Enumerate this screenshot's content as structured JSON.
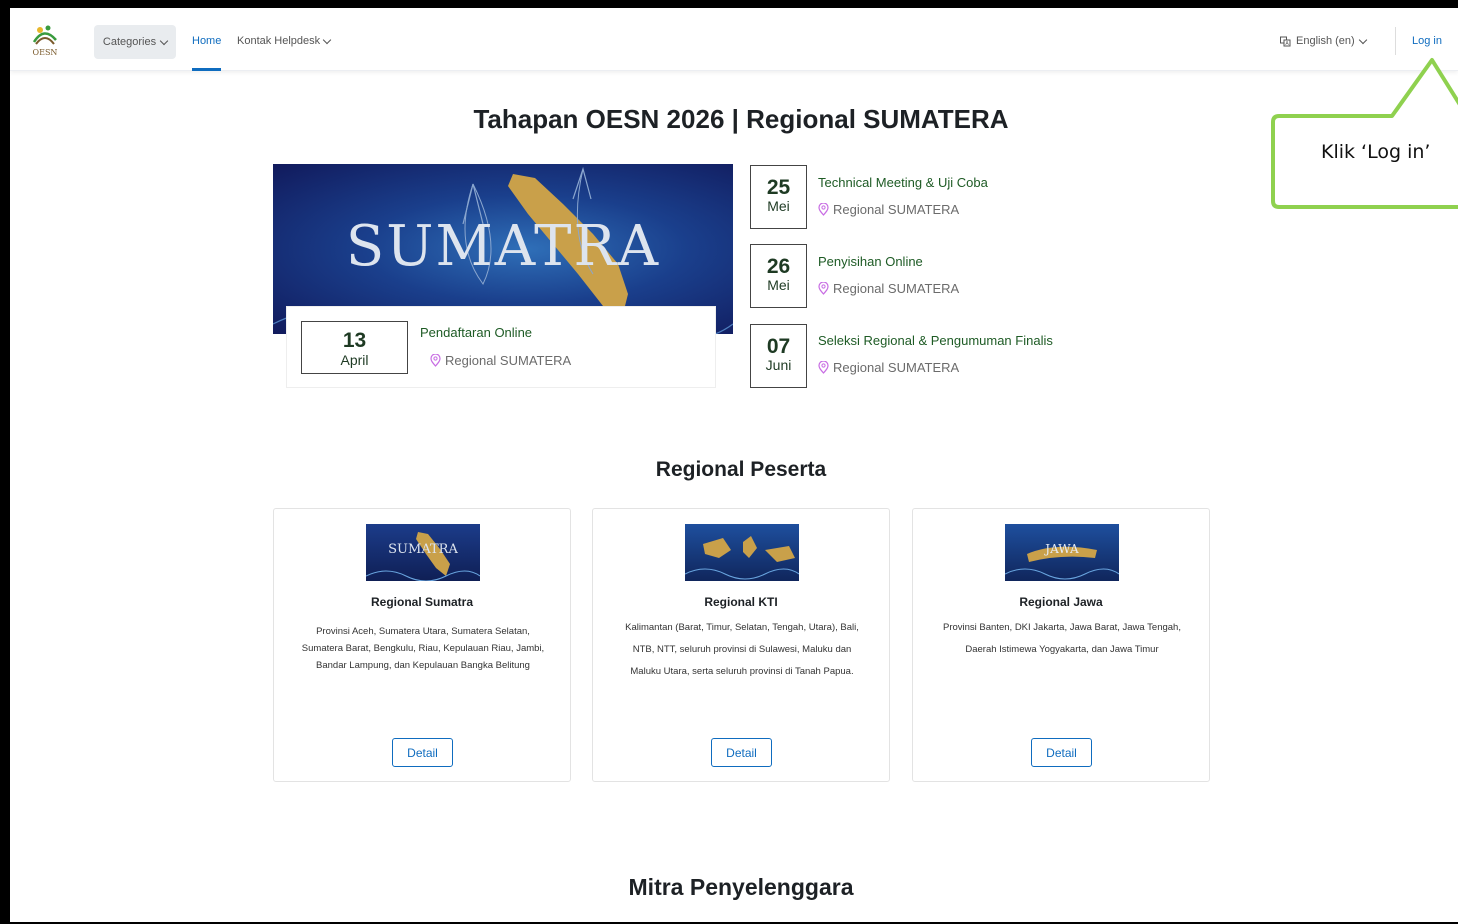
{
  "navbar": {
    "categories_label": "Categories",
    "home_label": "Home",
    "helpdesk_label": "Kontak Helpdesk",
    "language_label": "English (en)",
    "login_label": "Log in"
  },
  "callout": {
    "text": "Klik ‘Log in’"
  },
  "hero": {
    "title": "Tahapan OESN 2026 | Regional SUMATERA",
    "banner_word": "SUMATRA",
    "main_event": {
      "day": "13",
      "month": "April",
      "title": "Pendaftaran Online",
      "location": "Regional SUMATERA"
    },
    "events": [
      {
        "day": "25",
        "month": "Mei",
        "title": "Technical Meeting & Uji Coba",
        "location": "Regional SUMATERA"
      },
      {
        "day": "26",
        "month": "Mei",
        "title": "Penyisihan Online",
        "location": "Regional SUMATERA"
      },
      {
        "day": "07",
        "month": "Juni",
        "title": "Seleksi Regional & Pengumuman Finalis",
        "location": "Regional SUMATERA"
      }
    ]
  },
  "regional": {
    "heading": "Regional Peserta",
    "cards": [
      {
        "image_word": "SUMATRA",
        "title": "Regional Sumatra",
        "description": "Provinsi Aceh, Sumatera Utara, Sumatera Selatan, Sumatera Barat, Bengkulu, Riau, Kepulauan Riau, Jambi, Bandar Lampung, dan Kepulauan Bangka Belitung",
        "button": "Detail"
      },
      {
        "image_word": "",
        "title": "Regional KTI",
        "description": "Kalimantan (Barat, Timur, Selatan, Tengah, Utara), Bali, NTB, NTT, seluruh provinsi di Sulawesi, Maluku dan Maluku Utara, serta seluruh provinsi di Tanah Papua.",
        "button": "Detail"
      },
      {
        "image_word": "JAWA",
        "title": "Regional Jawa",
        "description": "Provinsi Banten, DKI Jakarta, Jawa Barat, Jawa Tengah, Daerah Istimewa Yogyakarta, dan Jawa Timur",
        "button": "Detail"
      }
    ]
  },
  "mitra": {
    "heading": "Mitra Penyelenggara"
  },
  "colors": {
    "brand_blue": "#0f6cbf",
    "event_green": "#1e5b25",
    "callout_green": "#8fd14f",
    "location_pin": "#c86de3"
  },
  "icons": [
    "oesn-logo-icon",
    "chevron-down-icon",
    "language-icon",
    "location-pin-icon"
  ]
}
